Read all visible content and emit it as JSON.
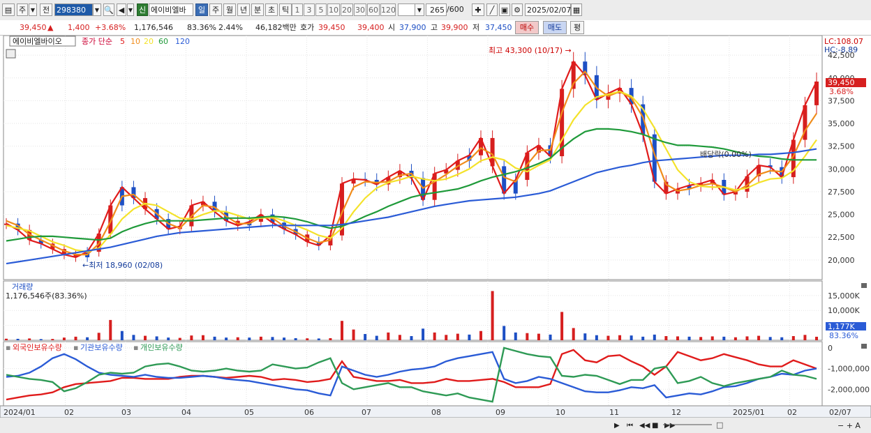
{
  "toolbar": {
    "period_short": "주",
    "prev_label": "전",
    "code": "298380",
    "type_badge": "신",
    "stock_name": "에이비엘바",
    "periods": [
      "일",
      "주",
      "월",
      "년",
      "분",
      "초",
      "틱"
    ],
    "active_period": "일",
    "steps": [
      "1",
      "3",
      "5",
      "10",
      "20",
      "30",
      "60",
      "120"
    ],
    "count": "265",
    "count_max": "/600",
    "date": "2025/02/07"
  },
  "quote": {
    "price": "39,450",
    "arrow": "▲",
    "change": "1,400",
    "change_pct": "+3.68%",
    "volume": "1,176,546",
    "volume_ratio": "83.36%",
    "turnover": "2.44%",
    "amount": "46,182백만",
    "ask_label": "호가",
    "ask": "39,450",
    "bid": "39,400",
    "open_label": "시",
    "open": "37,900",
    "high_label": "고",
    "high": "39,900",
    "low_label": "저",
    "low": "37,450",
    "buy_label": "매수",
    "sell_label": "매도",
    "eval_label": "평"
  },
  "colors": {
    "up": "#d61f1f",
    "down": "#1d4fc4",
    "ma5": "#e01b1b",
    "ma10": "#f08c1a",
    "ma20": "#f4e22a",
    "ma60": "#1f9a3a",
    "ma120": "#2a5bd6",
    "foreign": "#e01b1b",
    "institution": "#2a5bd6",
    "individual": "#2e9a55"
  },
  "chart_data": [
    {
      "type": "line",
      "title": "에이비엘바이오",
      "legend": [
        "종가 단순",
        "5",
        "10",
        "20",
        "60",
        "120"
      ],
      "series": [
        {
          "name": "5",
          "values": [
            24000,
            23300,
            22200,
            21800,
            21200,
            20600,
            20300,
            20900,
            22900,
            26000,
            28000,
            26800,
            25600,
            24500,
            23400,
            23700,
            26000,
            26400,
            25300,
            24300,
            23800,
            24200,
            25000,
            24100,
            23400,
            22800,
            22000,
            21600,
            22700,
            28400,
            28900,
            28800,
            28300,
            29100,
            29800,
            29000,
            26600,
            29500,
            29900,
            30900,
            31500,
            33400,
            30300,
            27300,
            28800,
            31800,
            32600,
            31400,
            38800,
            41800,
            40300,
            37600,
            38300,
            38900,
            37100,
            33800,
            28600,
            27300,
            27800,
            28200,
            28400,
            28800,
            27200,
            27500,
            29200,
            30400,
            30200,
            29100,
            33200,
            37000,
            39600
          ]
        },
        {
          "name": "10",
          "values": [
            24300,
            23800,
            22800,
            22200,
            21600,
            21000,
            20600,
            20600,
            21800,
            24200,
            27000,
            27200,
            26100,
            25100,
            24000,
            23500,
            24800,
            26000,
            25800,
            24800,
            24000,
            24000,
            24700,
            24600,
            23700,
            23100,
            22400,
            21900,
            22200,
            25200,
            28000,
            28600,
            28500,
            28600,
            29300,
            29500,
            27900,
            28600,
            29400,
            30300,
            31000,
            32300,
            31600,
            29100,
            28600,
            30500,
            32000,
            32100,
            36200,
            39400,
            40700,
            38900,
            38000,
            38500,
            37800,
            35700,
            31600,
            28300,
            27600,
            27800,
            28200,
            28400,
            28000,
            27500,
            28200,
            29400,
            29800,
            29700,
            31400,
            34200,
            36100
          ]
        },
        {
          "name": "20",
          "values": [
            23800,
            23500,
            23200,
            22600,
            22000,
            21600,
            21100,
            20900,
            21300,
            22800,
            24500,
            25600,
            26200,
            26000,
            25300,
            24600,
            24500,
            25000,
            25400,
            25300,
            24900,
            24500,
            24600,
            24700,
            24300,
            23800,
            23300,
            22700,
            22400,
            23500,
            25300,
            26800,
            27900,
            28500,
            28800,
            29200,
            28900,
            28700,
            28900,
            29400,
            30000,
            30900,
            31300,
            31000,
            30100,
            29700,
            30400,
            31000,
            33200,
            35400,
            37000,
            37900,
            38200,
            38500,
            38000,
            36600,
            34500,
            32200,
            29900,
            28600,
            28100,
            28000,
            28000,
            27700,
            27900,
            28500,
            28900,
            29000,
            29800,
            31400,
            33200
          ]
        },
        {
          "name": "60",
          "values": [
            22100,
            22300,
            22500,
            22600,
            22600,
            22500,
            22400,
            22300,
            22200,
            22400,
            23100,
            23600,
            24000,
            24300,
            24300,
            24300,
            24300,
            24400,
            24500,
            24600,
            24600,
            24600,
            24700,
            24800,
            24700,
            24500,
            24200,
            23800,
            23500,
            23700,
            24200,
            24800,
            25300,
            25900,
            26400,
            26900,
            27200,
            27400,
            27600,
            27800,
            28200,
            28700,
            29100,
            29400,
            29700,
            30100,
            30600,
            31200,
            32300,
            33300,
            34100,
            34400,
            34400,
            34300,
            34100,
            33800,
            33300,
            32900,
            32600,
            32600,
            32500,
            32400,
            32200,
            31900,
            31600,
            31400,
            31300,
            31100,
            31000,
            31000,
            31000
          ]
        },
        {
          "name": "120",
          "values": [
            19600,
            19800,
            20000,
            20200,
            20400,
            20600,
            20800,
            21000,
            21200,
            21400,
            21700,
            22000,
            22300,
            22600,
            22800,
            23000,
            23100,
            23200,
            23300,
            23400,
            23500,
            23600,
            23700,
            23800,
            23800,
            23800,
            23800,
            23800,
            23800,
            23900,
            24100,
            24300,
            24500,
            24700,
            25000,
            25300,
            25600,
            25900,
            26100,
            26300,
            26500,
            26600,
            26700,
            26800,
            26900,
            27100,
            27300,
            27600,
            28100,
            28600,
            29100,
            29600,
            29900,
            30200,
            30400,
            30700,
            30900,
            31000,
            31100,
            31200,
            31300,
            31400,
            31500,
            31500,
            31500,
            31600,
            31600,
            31700,
            31800,
            32000,
            32200
          ]
        }
      ],
      "ylim": [
        18000,
        44500
      ],
      "y_ticks": [
        "20,000",
        "22,500",
        "25,000",
        "27,500",
        "30,000",
        "32,500",
        "35,000",
        "37,500",
        "40,000",
        "42,500"
      ],
      "x_labels": [
        "2024/01",
        "02",
        "03",
        "04",
        "05",
        "06",
        "07",
        "08",
        "09",
        "10",
        "11",
        "12",
        "2025/01",
        "02",
        "02/07"
      ],
      "annotations": {
        "high": "최고 43,300 (10/17)",
        "low": "최저 18,960 (02/08)",
        "dividend": "배당락(0.00%)",
        "lc": "LC:108.07",
        "hc": "HC:-8.89",
        "last_price": "39,450",
        "last_pct": "3.68%"
      }
    },
    {
      "type": "bar",
      "title": "거래량",
      "subtitle": "1,176,546주(83.36%)",
      "y_ticks": [
        "5,000K",
        "10,000K",
        "15,000K"
      ],
      "ylim": [
        0,
        18000
      ],
      "current_label": "1,177K",
      "current_pct": "83.36%",
      "values": [
        520,
        480,
        610,
        390,
        440,
        900,
        1200,
        1000,
        2500,
        6800,
        3100,
        1800,
        1500,
        1300,
        900,
        800,
        1600,
        1700,
        1200,
        900,
        1000,
        900,
        1200,
        1100,
        900,
        700,
        650,
        600,
        700,
        6500,
        3600,
        2100,
        1500,
        2600,
        1800,
        1400,
        3900,
        2600,
        1800,
        2200,
        1900,
        3100,
        16500,
        4800,
        2600,
        2400,
        2200,
        1900,
        9500,
        4100,
        2300,
        1700,
        1500,
        1700,
        1600,
        1200,
        1900,
        1400,
        1300,
        1200,
        1100,
        1300,
        1200,
        1000,
        1300,
        1500,
        1100,
        1000,
        1400,
        1800,
        1177
      ],
      "up": [
        1,
        0,
        1,
        0,
        1,
        1,
        1,
        0,
        1,
        1,
        0,
        0,
        1,
        0,
        0,
        1,
        1,
        1,
        0,
        0,
        1,
        0,
        1,
        0,
        0,
        0,
        1,
        0,
        1,
        1,
        1,
        0,
        0,
        1,
        1,
        0,
        0,
        1,
        1,
        1,
        0,
        1,
        1,
        0,
        0,
        1,
        1,
        0,
        1,
        1,
        0,
        0,
        1,
        1,
        0,
        0,
        0,
        1,
        1,
        0,
        1,
        1,
        0,
        1,
        1,
        1,
        0,
        0,
        1,
        1,
        1
      ]
    },
    {
      "type": "line",
      "title": "보유수량",
      "legend": [
        "외국인보유수량",
        "기관보유수량",
        "개인보유수량"
      ],
      "y_ticks": [
        "0",
        "-1,000,000",
        "-2,000,000"
      ],
      "ylim": [
        -2800000,
        300000
      ],
      "series": [
        {
          "name": "외국인보유수량",
          "values": [
            -2500000,
            -2400000,
            -2300000,
            -2250000,
            -2150000,
            -1900000,
            -1750000,
            -1700000,
            -1650000,
            -1600000,
            -1450000,
            -1450000,
            -1500000,
            -1500000,
            -1500000,
            -1400000,
            -1350000,
            -1350000,
            -1400000,
            -1450000,
            -1400000,
            -1350000,
            -1400000,
            -1550000,
            -1500000,
            -1550000,
            -1650000,
            -1600000,
            -1500000,
            -650000,
            -1400000,
            -1500000,
            -1600000,
            -1600000,
            -1550000,
            -1700000,
            -1700000,
            -1650000,
            -1500000,
            -1600000,
            -1600000,
            -1550000,
            -1500000,
            -1650000,
            -1900000,
            -1900000,
            -1900000,
            -1750000,
            -300000,
            -100000,
            -600000,
            -700000,
            -400000,
            -350000,
            -650000,
            -900000,
            -1300000,
            -900000,
            -200000,
            -400000,
            -600000,
            -500000,
            -300000,
            -450000,
            -600000,
            -800000,
            -900000,
            -900000,
            -600000,
            -800000,
            -1000000
          ]
        },
        {
          "name": "기관보유수량",
          "values": [
            -1400000,
            -1350000,
            -1200000,
            -900000,
            -500000,
            -300000,
            -550000,
            -900000,
            -1200000,
            -1300000,
            -1350000,
            -1400000,
            -1300000,
            -1400000,
            -1450000,
            -1450000,
            -1400000,
            -1350000,
            -1400000,
            -1500000,
            -1550000,
            -1600000,
            -1700000,
            -1800000,
            -1900000,
            -2000000,
            -2050000,
            -2200000,
            -2300000,
            -900000,
            -1100000,
            -1300000,
            -1400000,
            -1300000,
            -1150000,
            -1050000,
            -1000000,
            -900000,
            -650000,
            -500000,
            -400000,
            -300000,
            -200000,
            -1500000,
            -1700000,
            -1600000,
            -1400000,
            -1500000,
            -1700000,
            -1900000,
            -2100000,
            -2150000,
            -2150000,
            -2050000,
            -1900000,
            -1950000,
            -1800000,
            -2400000,
            -2300000,
            -2200000,
            -2250000,
            -2100000,
            -1900000,
            -1850000,
            -1700000,
            -1500000,
            -1400000,
            -1250000,
            -1300000,
            -1100000,
            -1000000
          ]
        },
        {
          "name": "개인보유수량",
          "values": [
            -1300000,
            -1400000,
            -1500000,
            -1550000,
            -1650000,
            -2100000,
            -1950000,
            -1650000,
            -1300000,
            -1200000,
            -1250000,
            -1200000,
            -900000,
            -800000,
            -750000,
            -900000,
            -1100000,
            -1150000,
            -1100000,
            -1000000,
            -1100000,
            -1150000,
            -1100000,
            -800000,
            -900000,
            -1000000,
            -950000,
            -700000,
            -500000,
            -1700000,
            -2000000,
            -1900000,
            -1800000,
            -1700000,
            -1900000,
            -1900000,
            -2100000,
            -2200000,
            -2300000,
            -2200000,
            -2400000,
            -2500000,
            -2600000,
            0,
            -150000,
            -300000,
            -400000,
            -450000,
            -1350000,
            -1400000,
            -1300000,
            -1350000,
            -1550000,
            -1750000,
            -1550000,
            -1550000,
            -1000000,
            -900000,
            -1700000,
            -1600000,
            -1400000,
            -1700000,
            -1850000,
            -1700000,
            -1600000,
            -1500000,
            -1400000,
            -1100000,
            -1300000,
            -1350000,
            -1500000
          ]
        }
      ]
    }
  ],
  "icons": [
    "chart-type-icon",
    "search-icon",
    "speaker-icon",
    "settings-icon",
    "save-icon",
    "crosshair-icon",
    "zoom-in-icon",
    "zoom-out-icon"
  ]
}
